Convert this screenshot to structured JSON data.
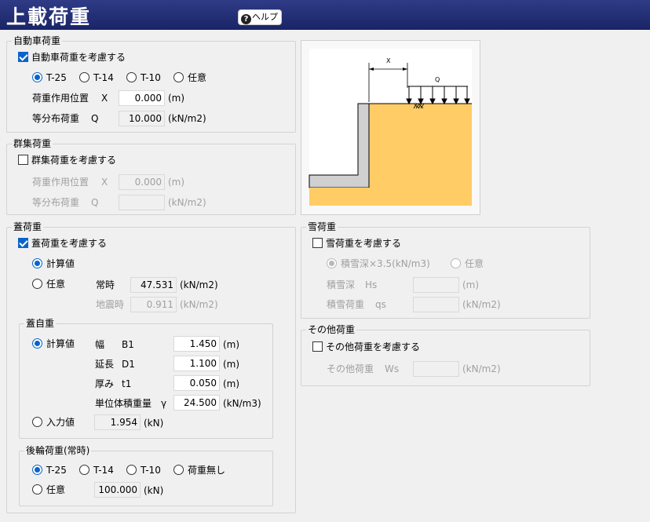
{
  "header": {
    "title": "上載荷重",
    "help_label": "ヘルプ",
    "help_icon": "?"
  },
  "vehicle": {
    "title": "自動車荷重",
    "checkbox_label": "自動車荷重を考慮する",
    "checked": true,
    "types": [
      "T-25",
      "T-14",
      "T-10",
      "任意"
    ],
    "selected": "T-25",
    "pos_label": "荷重作用位置",
    "pos_sym": "X",
    "pos_value": "0.000",
    "pos_unit": "(m)",
    "load_label": "等分布荷重",
    "load_sym": "Q",
    "load_value": "10.000",
    "load_unit": "(kN/m2)"
  },
  "crowd": {
    "title": "群集荷重",
    "checkbox_label": "群集荷重を考慮する",
    "checked": false,
    "pos_label": "荷重作用位置",
    "pos_sym": "X",
    "pos_value": "0.000",
    "pos_unit": "(m)",
    "load_label": "等分布荷重",
    "load_sym": "Q",
    "load_value": "",
    "load_unit": "(kN/m2)"
  },
  "diagram": {
    "x_label": "X",
    "q_label": "Q"
  },
  "cover": {
    "title": "蓋荷重",
    "checkbox_label": "蓋荷重を考慮する",
    "checked": true,
    "opt_calc": "計算値",
    "opt_any": "任意",
    "normal_label": "常時",
    "normal_value": "47.531",
    "normal_unit": "(kN/m2)",
    "quake_label": "地震時",
    "quake_value": "0.911",
    "quake_unit": "(kN/m2)",
    "self": {
      "title": "蓋自重",
      "opt_calc": "計算値",
      "width_label": "幅",
      "width_sym": "B1",
      "width_value": "1.450",
      "width_unit": "(m)",
      "len_label": "延長",
      "len_sym": "D1",
      "len_value": "1.100",
      "len_unit": "(m)",
      "thick_label": "厚み",
      "thick_sym": "t1",
      "thick_value": "0.050",
      "thick_unit": "(m)",
      "unit_label": "単位体積重量",
      "unit_sym": "γ",
      "unit_value": "24.500",
      "unit_unit": "(kN/m3)",
      "opt_input": "入力値",
      "input_value": "1.954",
      "input_unit": "(kN)"
    },
    "rear": {
      "title": "後輪荷重(常時)",
      "types": [
        "T-25",
        "T-14",
        "T-10",
        "荷重無し"
      ],
      "selected": "T-25",
      "opt_any": "任意",
      "any_value": "100.000",
      "any_unit": "(kN)"
    }
  },
  "snow": {
    "title": "雪荷重",
    "checkbox_label": "雪荷重を考慮する",
    "checked": false,
    "opt_depth": "積雪深×3.5(kN/m3)",
    "opt_any": "任意",
    "depth_label": "積雪深",
    "depth_sym": "Hs",
    "depth_unit": "(m)",
    "load_label": "積雪荷重",
    "load_sym": "qs",
    "load_unit": "(kN/m2)"
  },
  "other": {
    "title": "その他荷重",
    "checkbox_label": "その他荷重を考慮する",
    "checked": false,
    "load_label": "その他荷重",
    "load_sym": "Ws",
    "load_unit": "(kN/m2)"
  },
  "colors": {
    "header": "#1f2a72",
    "accent": "#0a64c8",
    "soil": "#ffcc66",
    "wall": "#d0d0d0"
  }
}
